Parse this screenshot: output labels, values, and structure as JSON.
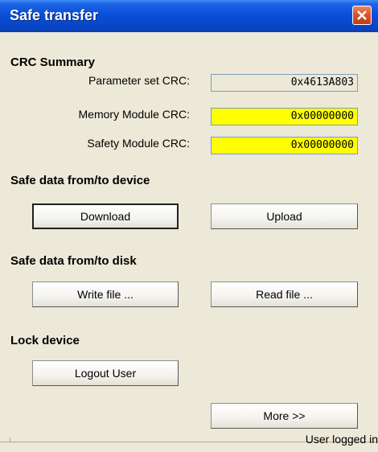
{
  "window": {
    "title": "Safe transfer"
  },
  "crc": {
    "heading": "CRC Summary",
    "rows": [
      {
        "label": "Parameter set CRC:",
        "value": "0x4613A803",
        "highlight": "#ece9d8"
      },
      {
        "label": "Memory Module CRC:",
        "value": "0x00000000",
        "highlight": "#ffff00"
      },
      {
        "label": "Safety Module CRC:",
        "value": "0x00000000",
        "highlight": "#ffff00"
      }
    ]
  },
  "device": {
    "heading": "Safe data from/to device",
    "download_label": "Download",
    "upload_label": "Upload"
  },
  "disk": {
    "heading": "Safe data from/to disk",
    "write_label": "Write file ...",
    "read_label": "Read file ..."
  },
  "lock": {
    "heading": "Lock device",
    "logout_label": "Logout User"
  },
  "more_label": "More >>",
  "status": {
    "text": "User logged in"
  }
}
